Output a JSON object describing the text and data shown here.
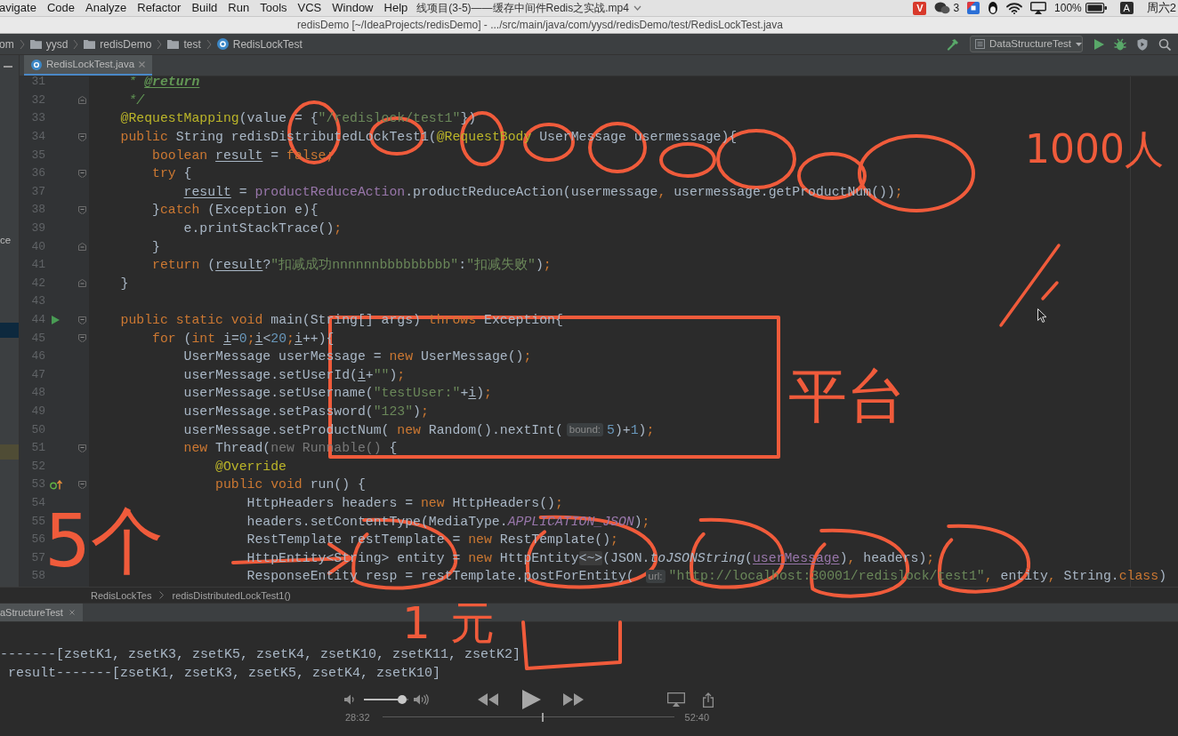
{
  "menu_bar": {
    "items": [
      "avigate",
      "Code",
      "Analyze",
      "Refactor",
      "Build",
      "Run",
      "Tools",
      "VCS",
      "Window",
      "Help"
    ],
    "video_title": "线项目(3-5)——缓存中间件Redis之实战.mp4",
    "badge_letter": "V",
    "chat_count": "3",
    "battery": "100%",
    "input_source": "A",
    "clock": "周六2"
  },
  "window": {
    "title": "redisDemo [~/IdeaProjects/redisDemo] - .../src/main/java/com/yysd/redisDemo/test/RedisLockTest.java"
  },
  "navigation_bar": {
    "crumbs": [
      {
        "kind": "text",
        "label": "om"
      },
      {
        "kind": "folder",
        "label": "yysd"
      },
      {
        "kind": "folder",
        "label": "redisDemo"
      },
      {
        "kind": "folder",
        "label": "test"
      },
      {
        "kind": "class",
        "label": "RedisLockTest"
      }
    ],
    "run_configuration": "DataStructureTest"
  },
  "project_panel": {
    "label": "ce"
  },
  "tabs": [
    {
      "label": "RedisLockTest.java",
      "selected": true
    }
  ],
  "editor": {
    "lines": [
      {
        "number": "31",
        "tokens": [
          {
            "kind": "doc",
            "text": "     * "
          },
          {
            "kind": "doc-tag",
            "text": "@return"
          }
        ]
      },
      {
        "number": "32",
        "gutter": [
          {
            "kind": "fold-end"
          }
        ],
        "tokens": [
          {
            "kind": "doc",
            "text": "     */"
          }
        ]
      },
      {
        "number": "33",
        "tokens": [
          {
            "kind": "annotation",
            "text": "    @RequestMapping"
          },
          {
            "kind": "plain",
            "text": "(value = {"
          },
          {
            "kind": "string",
            "text": "\"/redislock/test1\""
          },
          {
            "kind": "plain",
            "text": "})"
          }
        ]
      },
      {
        "number": "34",
        "gutter": [
          {
            "kind": "fold-start"
          }
        ],
        "tokens": [
          {
            "kind": "keyword",
            "text": "    public "
          },
          {
            "kind": "plain",
            "text": "String redisDistributedLockTest1("
          },
          {
            "kind": "annotation",
            "text": "@RequestBody "
          },
          {
            "kind": "plain",
            "text": "UserMessage usermessage){"
          }
        ]
      },
      {
        "number": "35",
        "tokens": [
          {
            "kind": "keyword",
            "text": "        boolean "
          },
          {
            "kind": "var",
            "text": "result"
          },
          {
            "kind": "plain",
            "text": " = "
          },
          {
            "kind": "keyword",
            "text": "false;"
          }
        ]
      },
      {
        "number": "36",
        "gutter": [
          {
            "kind": "fold-start"
          }
        ],
        "tokens": [
          {
            "kind": "keyword",
            "text": "        try "
          },
          {
            "kind": "plain",
            "text": "{"
          }
        ]
      },
      {
        "number": "37",
        "tokens": [
          {
            "kind": "var",
            "text": "            result"
          },
          {
            "kind": "plain",
            "text": " = "
          },
          {
            "kind": "field",
            "text": "productReduceAction"
          },
          {
            "kind": "plain",
            "text": ".productReduceAction(usermessage"
          },
          {
            "kind": "keyword",
            "text": ", "
          },
          {
            "kind": "plain",
            "text": "usermessage.getProductNum())"
          },
          {
            "kind": "keyword",
            "text": ";"
          }
        ]
      },
      {
        "number": "38",
        "gutter": [
          {
            "kind": "fold-start"
          }
        ],
        "tokens": [
          {
            "kind": "plain",
            "text": "        }"
          },
          {
            "kind": "keyword",
            "text": "catch "
          },
          {
            "kind": "plain",
            "text": "(Exception e){"
          }
        ]
      },
      {
        "number": "39",
        "tokens": [
          {
            "kind": "plain",
            "text": "            e.printStackTrace()"
          },
          {
            "kind": "keyword",
            "text": ";"
          }
        ]
      },
      {
        "number": "40",
        "gutter": [
          {
            "kind": "fold-end"
          }
        ],
        "tokens": [
          {
            "kind": "plain",
            "text": "        }"
          }
        ]
      },
      {
        "number": "41",
        "tokens": [
          {
            "kind": "keyword",
            "text": "        return "
          },
          {
            "kind": "plain",
            "text": "("
          },
          {
            "kind": "var",
            "text": "result"
          },
          {
            "kind": "plain",
            "text": "?"
          },
          {
            "kind": "string",
            "text": "\"扣减成功nnnnnnbbbbbbbbb\""
          },
          {
            "kind": "plain",
            "text": ":"
          },
          {
            "kind": "string",
            "text": "\"扣减失败\""
          },
          {
            "kind": "plain",
            "text": ")"
          },
          {
            "kind": "keyword",
            "text": ";"
          }
        ]
      },
      {
        "number": "42",
        "gutter": [
          {
            "kind": "fold-end"
          }
        ],
        "tokens": [
          {
            "kind": "plain",
            "text": "    }"
          }
        ]
      },
      {
        "number": "43"
      },
      {
        "number": "44",
        "gutter": [
          {
            "kind": "run"
          },
          {
            "kind": "fold-start"
          }
        ],
        "tokens": [
          {
            "kind": "keyword",
            "text": "    public static void "
          },
          {
            "kind": "plain",
            "text": "main(String[] args) "
          },
          {
            "kind": "keyword",
            "text": "throws "
          },
          {
            "kind": "plain",
            "text": "Exception{"
          }
        ]
      },
      {
        "number": "45",
        "gutter": [
          {
            "kind": "fold-start"
          }
        ],
        "tokens": [
          {
            "kind": "keyword",
            "text": "        for "
          },
          {
            "kind": "plain",
            "text": "("
          },
          {
            "kind": "keyword",
            "text": "int "
          },
          {
            "kind": "var",
            "text": "i"
          },
          {
            "kind": "plain",
            "text": "="
          },
          {
            "kind": "number",
            "text": "0"
          },
          {
            "kind": "keyword",
            "text": ";"
          },
          {
            "kind": "var",
            "text": "i"
          },
          {
            "kind": "plain",
            "text": "<"
          },
          {
            "kind": "number",
            "text": "20"
          },
          {
            "kind": "keyword",
            "text": ";"
          },
          {
            "kind": "var",
            "text": "i"
          },
          {
            "kind": "plain",
            "text": "++){"
          }
        ]
      },
      {
        "number": "46",
        "tokens": [
          {
            "kind": "plain",
            "text": "            UserMessage userMessage = "
          },
          {
            "kind": "keyword",
            "text": "new "
          },
          {
            "kind": "plain",
            "text": "UserMessage()"
          },
          {
            "kind": "keyword",
            "text": ";"
          }
        ]
      },
      {
        "number": "47",
        "tokens": [
          {
            "kind": "plain",
            "text": "            userMessage.setUserId("
          },
          {
            "kind": "var",
            "text": "i"
          },
          {
            "kind": "plain",
            "text": "+"
          },
          {
            "kind": "string",
            "text": "\"\""
          },
          {
            "kind": "plain",
            "text": ")"
          },
          {
            "kind": "keyword",
            "text": ";"
          }
        ]
      },
      {
        "number": "48",
        "tokens": [
          {
            "kind": "plain",
            "text": "            userMessage.setUsername("
          },
          {
            "kind": "string",
            "text": "\"testUser:\""
          },
          {
            "kind": "plain",
            "text": "+"
          },
          {
            "kind": "var",
            "text": "i"
          },
          {
            "kind": "plain",
            "text": ")"
          },
          {
            "kind": "keyword",
            "text": ";"
          }
        ]
      },
      {
        "number": "49",
        "tokens": [
          {
            "kind": "plain",
            "text": "            userMessage.setPassword("
          },
          {
            "kind": "string",
            "text": "\"123\""
          },
          {
            "kind": "plain",
            "text": ")"
          },
          {
            "kind": "keyword",
            "text": ";"
          }
        ]
      },
      {
        "number": "50",
        "tokens": [
          {
            "kind": "plain",
            "text": "            userMessage.setProductNum( "
          },
          {
            "kind": "keyword",
            "text": "new "
          },
          {
            "kind": "plain",
            "text": "Random().nextInt("
          },
          {
            "kind": "hint",
            "text": "bound:"
          },
          {
            "kind": "number",
            "text": "5"
          },
          {
            "kind": "plain",
            "text": ")+"
          },
          {
            "kind": "number",
            "text": "1"
          },
          {
            "kind": "plain",
            "text": ")"
          },
          {
            "kind": "keyword",
            "text": ";"
          }
        ]
      },
      {
        "number": "51",
        "gutter": [
          {
            "kind": "fold-start"
          }
        ],
        "tokens": [
          {
            "kind": "keyword",
            "text": "            new "
          },
          {
            "kind": "plain",
            "text": "Thread("
          },
          {
            "kind": "dim",
            "text": "new Runnable() "
          },
          {
            "kind": "plain",
            "text": "{"
          }
        ]
      },
      {
        "number": "52",
        "tokens": [
          {
            "kind": "annotation",
            "text": "                @Override"
          }
        ]
      },
      {
        "number": "53",
        "gutter": [
          {
            "kind": "override"
          },
          {
            "kind": "fold-start"
          }
        ],
        "tokens": [
          {
            "kind": "keyword",
            "text": "                public void "
          },
          {
            "kind": "plain",
            "text": "run() {"
          }
        ]
      },
      {
        "number": "54",
        "tokens": [
          {
            "kind": "plain",
            "text": "                    HttpHeaders headers = "
          },
          {
            "kind": "keyword",
            "text": "new "
          },
          {
            "kind": "plain",
            "text": "HttpHeaders()"
          },
          {
            "kind": "keyword",
            "text": ";"
          }
        ]
      },
      {
        "number": "55",
        "tokens": [
          {
            "kind": "plain",
            "text": "                    headers.setContentType(MediaType."
          },
          {
            "kind": "static",
            "text": "APPLICATION_JSON"
          },
          {
            "kind": "plain",
            "text": ")"
          },
          {
            "kind": "keyword",
            "text": ";"
          }
        ]
      },
      {
        "number": "56",
        "tokens": [
          {
            "kind": "plain",
            "text": "                    RestTemplate restTemplate = "
          },
          {
            "kind": "keyword",
            "text": "new "
          },
          {
            "kind": "plain",
            "text": "RestTemplate()"
          },
          {
            "kind": "keyword",
            "text": ";"
          }
        ]
      },
      {
        "number": "57",
        "tokens": [
          {
            "kind": "plain",
            "text": "                    HttpEntity<String> entity = "
          },
          {
            "kind": "keyword",
            "text": "new "
          },
          {
            "kind": "plain",
            "text": "HttpEntity"
          },
          {
            "kind": "folded",
            "text": "<~>"
          },
          {
            "kind": "plain",
            "text": "(JSON."
          },
          {
            "kind": "italic",
            "text": "toJSONString"
          },
          {
            "kind": "plain",
            "text": "("
          },
          {
            "kind": "captured",
            "text": "userMessage"
          },
          {
            "kind": "plain",
            "text": ")"
          },
          {
            "kind": "keyword",
            "text": ", "
          },
          {
            "kind": "plain",
            "text": "headers)"
          },
          {
            "kind": "keyword",
            "text": ";"
          }
        ]
      },
      {
        "number": "58",
        "tokens": [
          {
            "kind": "plain",
            "text": "                    ResponseEntity resp = restTemplate.postForEntity( "
          },
          {
            "kind": "hint",
            "text": "url:"
          },
          {
            "kind": "string",
            "text": "\"http://localhost:30001/redislock/test1\""
          },
          {
            "kind": "keyword",
            "text": ", "
          },
          {
            "kind": "plain",
            "text": "entity"
          },
          {
            "kind": "keyword",
            "text": ", "
          },
          {
            "kind": "plain",
            "text": "String."
          },
          {
            "kind": "keyword",
            "text": "class"
          },
          {
            "kind": "plain",
            "text": ")"
          }
        ]
      }
    ]
  },
  "breadcrumbs": [
    "RedisLockTes",
    "redisDistributedLockTest1()"
  ],
  "run_panel": {
    "tabs": [
      {
        "label": "aStructureTest",
        "selected": true
      }
    ],
    "output": [
      "-------[zsetK1, zsetK3, zsetK5, zsetK4, zsetK10, zsetK11, zsetK2]",
      " result-------[zsetK1, zsetK3, zsetK5, zsetK4, zsetK10]"
    ]
  },
  "video_controls": {
    "volume": {
      "level": 0.85
    },
    "progress": {
      "level": 0.55
    },
    "elapsed": "28:32",
    "duration": "52:40"
  },
  "annotations": [
    {
      "text": "1000人"
    },
    {
      "text": "平台"
    },
    {
      "text": "5个"
    },
    {
      "text": "1元"
    }
  ]
}
